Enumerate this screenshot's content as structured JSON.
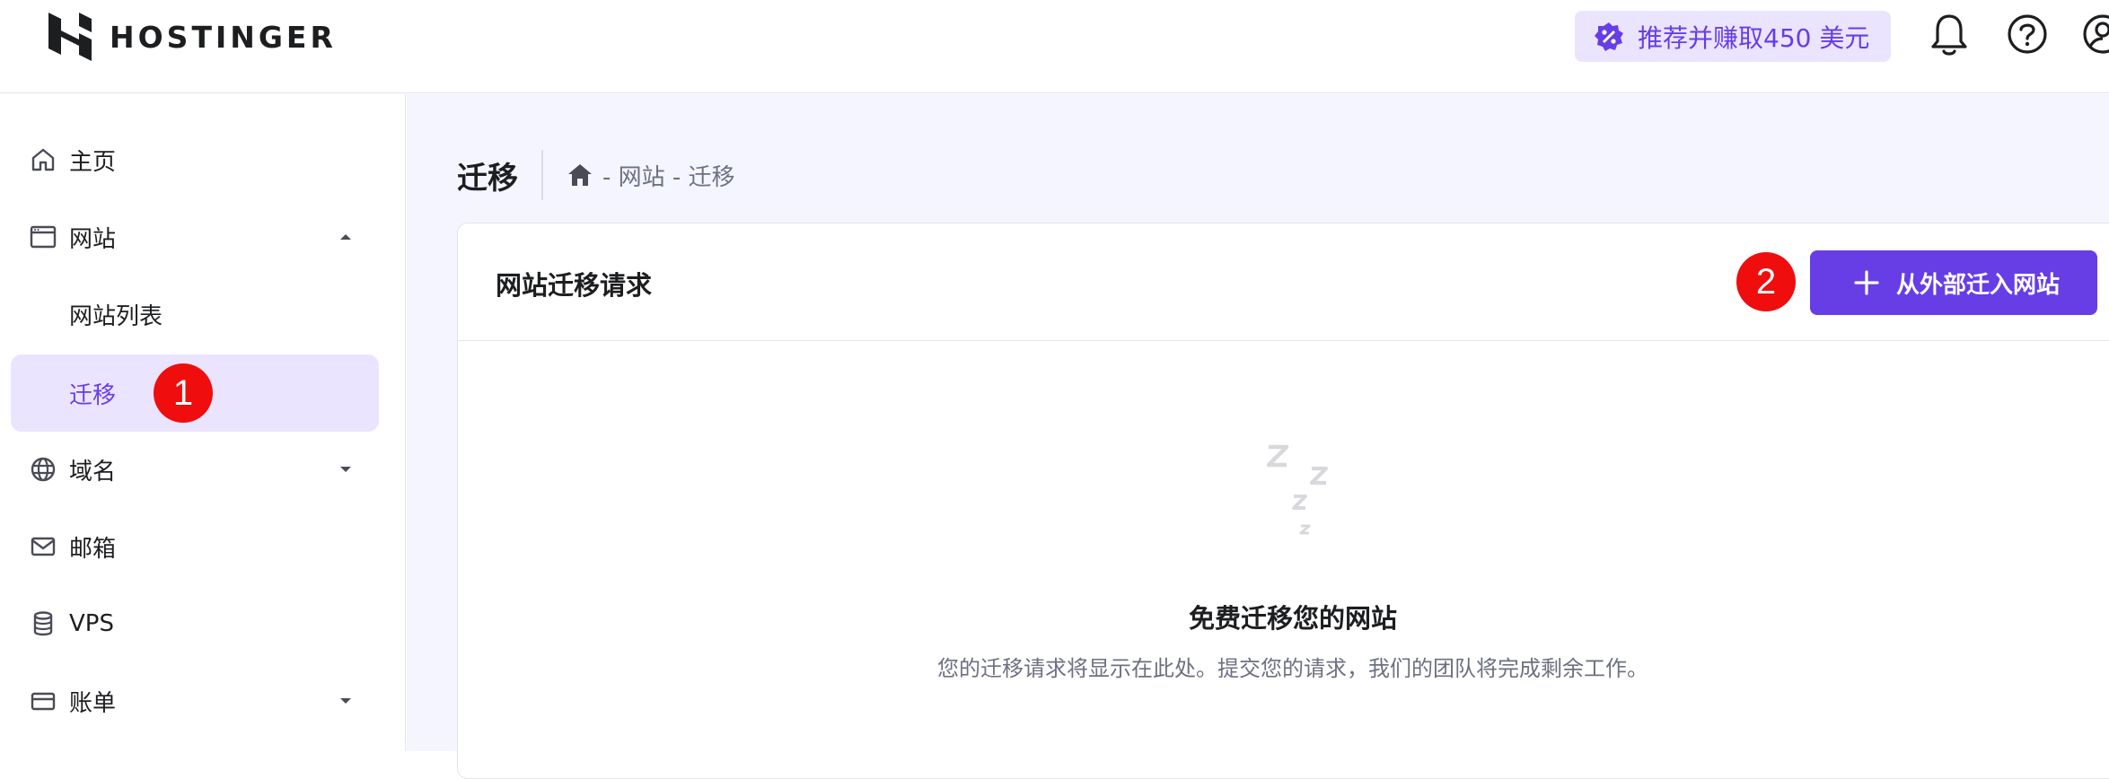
{
  "brand": {
    "name": "HOSTINGER"
  },
  "topbar": {
    "referral_label": "推荐并赚取450 美元",
    "icons": [
      "bell-icon",
      "help-icon",
      "account-icon",
      "referral-badge-icon"
    ]
  },
  "sidebar": {
    "items": [
      {
        "label": "主页",
        "icon": "home-icon"
      },
      {
        "label": "网站",
        "icon": "browser-window-icon",
        "expanded": true
      },
      {
        "label": "网站列表",
        "sub": true
      },
      {
        "label": "迁移",
        "sub": true,
        "active": true
      },
      {
        "label": "域名",
        "icon": "globe-icon"
      },
      {
        "label": "邮箱",
        "icon": "mail-icon"
      },
      {
        "label": "VPS",
        "icon": "database-icon"
      },
      {
        "label": "账单",
        "icon": "card-icon"
      }
    ]
  },
  "page": {
    "title": "迁移",
    "breadcrumb": [
      "- 网站 - 迁移"
    ]
  },
  "card": {
    "title": "网站迁移请求",
    "button_label": "从外部迁入网站",
    "empty_title": "免费迁移您的网站",
    "empty_description": "您的迁移请求将显示在此处。提交您的请求，我们的团队将完成剩余工作。"
  },
  "markers": [
    "1",
    "2"
  ],
  "colors": {
    "accent": "#673de6",
    "accent_light": "#ebe4ff",
    "marker": "#f00d0d",
    "background": "#f4f5ff"
  }
}
